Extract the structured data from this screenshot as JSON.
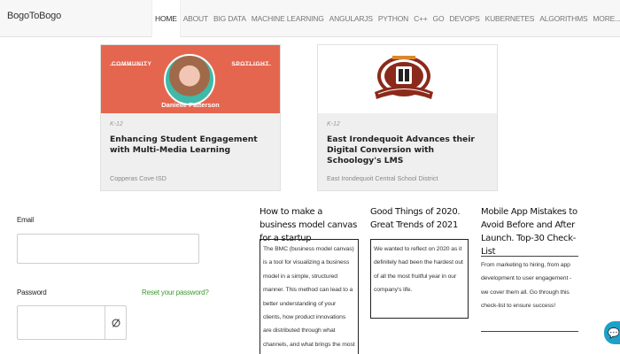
{
  "header": {
    "brand": "BogoToBogo",
    "nav": [
      {
        "label": "HOME",
        "active": true
      },
      {
        "label": "ABOUT",
        "active": false
      },
      {
        "label": "BIG DATA",
        "active": false
      },
      {
        "label": "MACHINE LEARNING",
        "active": false
      },
      {
        "label": "ANGULARJS",
        "active": false
      },
      {
        "label": "PYTHON",
        "active": false
      },
      {
        "label": "C++",
        "active": false
      },
      {
        "label": "GO",
        "active": false
      },
      {
        "label": "DEVOPS",
        "active": false
      },
      {
        "label": "KUBERNETES",
        "active": false
      },
      {
        "label": "ALGORITHMS",
        "active": false
      },
      {
        "label": "MORE...",
        "active": false
      }
    ]
  },
  "cards": [
    {
      "banner_left": "COMMUNITY",
      "banner_right": "SPOTLIGHT",
      "person": "Danielle Patterson",
      "tag": "K-12",
      "title": "Enhancing Student Engagement with Multi-Media Learning",
      "source": "Copperas Cove ISD"
    },
    {
      "tag": "K-12",
      "title": "East Irondequoit Advances their Digital Conversion with Schoology's LMS",
      "source": "East Irondequoit Central School District"
    }
  ],
  "login": {
    "email_label": "Email",
    "email_value": "",
    "password_label": "Password",
    "password_value": "",
    "reset_link": "Reset your password?"
  },
  "articles": [
    {
      "title": "How to make a business model canvas for a startup",
      "body": "The BMC (business model canvas) is a tool for visualizing a business model in a simple, structured manner. This method can lead to a better understanding of your clients, how product innovations are distributed through what channels, and what brings the most profit"
    },
    {
      "title": "Good Things of 2020. Great Trends of 2021",
      "body": "We wanted to reflect on 2020 as it definitely had been the hardest out of all the most fruitful year in our company's life."
    },
    {
      "title": "Mobile App Mistakes to Avoid Before and After Launch. Top-30 Check-List",
      "body": "From marketing to hiring, from app development to user engagement - we cover them all. Go through this check-list to ensure success!"
    }
  ],
  "colors": {
    "spotlight_bg": "#e5664f",
    "link_green": "#3c9a2e",
    "chat_blue": "#1ea0c9"
  },
  "icons": {
    "password_toggle": "eye-slash-icon",
    "chat": "chat-icon"
  }
}
